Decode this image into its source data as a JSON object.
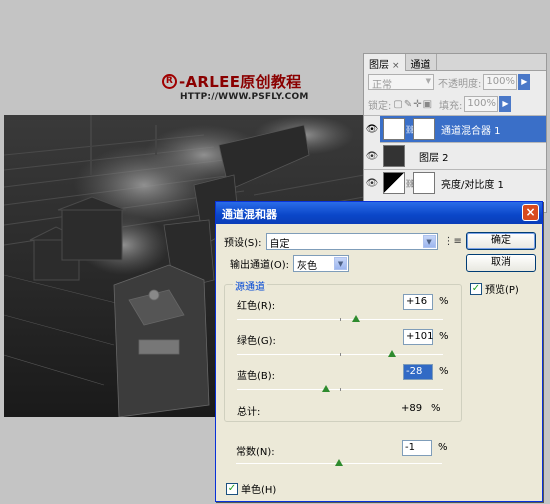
{
  "watermark": {
    "brand": "-ARLEE原创教程",
    "brand_mark": "R",
    "url": "HTTP://WWW.PSFLY.COM"
  },
  "layers_panel": {
    "tabs": [
      "图层",
      "通道"
    ],
    "tab_close": "×",
    "blend_mode": "正常",
    "opacity_label": "不透明度:",
    "opacity_value": "100%",
    "lock_label": "锁定:",
    "fill_label": "填充:",
    "fill_value": "100%",
    "layers": [
      {
        "name": "通道混合器 1",
        "selected": true
      },
      {
        "name": "图层 2",
        "selected": false
      },
      {
        "name": "亮度/对比度 1",
        "selected": false
      }
    ]
  },
  "dialog": {
    "title": "通道混和器",
    "close": "×",
    "preset_label": "预设(S):",
    "preset_value": "自定",
    "ok": "确定",
    "cancel": "取消",
    "preview_label": "预览(P)",
    "output_label": "输出通道(O):",
    "output_value": "灰色",
    "source_group": "源通道",
    "channels": [
      {
        "label": "红色(R):",
        "value": "+16",
        "pct": "%",
        "slider": 0.58
      },
      {
        "label": "绿色(G):",
        "value": "+101",
        "pct": "%",
        "slider": 0.75
      },
      {
        "label": "蓝色(B):",
        "value": "-28",
        "pct": "%",
        "slider": 0.43
      }
    ],
    "total_label": "总计:",
    "total_value": "+89",
    "total_pct": "%",
    "constant_label": "常数(N):",
    "constant_value": "-1",
    "constant_pct": "%",
    "constant_slider": 0.5,
    "mono_label": "单色(H)"
  }
}
